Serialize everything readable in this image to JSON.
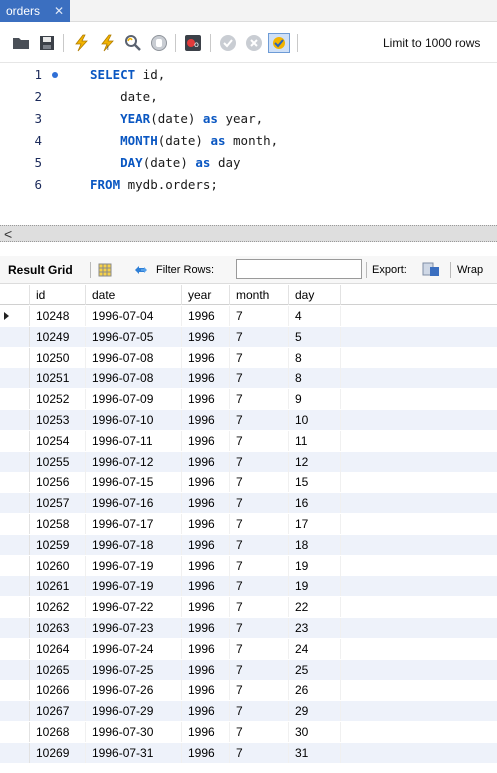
{
  "tab": {
    "label": "orders",
    "close_glyph": "✕"
  },
  "toolbar": {
    "icons": [
      "open-folder-icon",
      "save-icon",
      "execute-icon",
      "execute-current-icon",
      "explain-icon",
      "stop-icon",
      "toggle-error-icon",
      "commit-icon",
      "rollback-icon",
      "autocommit-icon"
    ],
    "limit_label": "Limit to 1000 rows"
  },
  "editor": {
    "lines": [
      {
        "num": "1",
        "parts": [
          [
            "kw",
            "SELECT"
          ],
          [
            "plain",
            " id,"
          ]
        ]
      },
      {
        "num": "2",
        "parts": [
          [
            "plain",
            "    date,"
          ]
        ]
      },
      {
        "num": "3",
        "parts": [
          [
            "plain",
            "    "
          ],
          [
            "fn",
            "YEAR"
          ],
          [
            "plain",
            "(date) "
          ],
          [
            "kw",
            "as"
          ],
          [
            "plain",
            " year,"
          ]
        ]
      },
      {
        "num": "4",
        "parts": [
          [
            "plain",
            "    "
          ],
          [
            "fn",
            "MONTH"
          ],
          [
            "plain",
            "(date) "
          ],
          [
            "kw",
            "as"
          ],
          [
            "plain",
            " month,"
          ]
        ]
      },
      {
        "num": "5",
        "parts": [
          [
            "plain",
            "    "
          ],
          [
            "fn",
            "DAY"
          ],
          [
            "plain",
            "(date) "
          ],
          [
            "kw",
            "as"
          ],
          [
            "plain",
            " day"
          ]
        ]
      },
      {
        "num": "6",
        "parts": [
          [
            "kw",
            "FROM"
          ],
          [
            "plain",
            " mydb.orders;"
          ]
        ]
      }
    ]
  },
  "scroll": {
    "left_arrow": "<"
  },
  "result_toolbar": {
    "result_grid_label": "Result Grid",
    "filter_label": "Filter Rows:",
    "filter_value": "",
    "export_label": "Export:",
    "wrap_label": "Wrap"
  },
  "grid": {
    "columns": [
      "id",
      "date",
      "year",
      "month",
      "day"
    ],
    "rows": [
      [
        "10248",
        "1996-07-04",
        "1996",
        "7",
        "4"
      ],
      [
        "10249",
        "1996-07-05",
        "1996",
        "7",
        "5"
      ],
      [
        "10250",
        "1996-07-08",
        "1996",
        "7",
        "8"
      ],
      [
        "10251",
        "1996-07-08",
        "1996",
        "7",
        "8"
      ],
      [
        "10252",
        "1996-07-09",
        "1996",
        "7",
        "9"
      ],
      [
        "10253",
        "1996-07-10",
        "1996",
        "7",
        "10"
      ],
      [
        "10254",
        "1996-07-11",
        "1996",
        "7",
        "11"
      ],
      [
        "10255",
        "1996-07-12",
        "1996",
        "7",
        "12"
      ],
      [
        "10256",
        "1996-07-15",
        "1996",
        "7",
        "15"
      ],
      [
        "10257",
        "1996-07-16",
        "1996",
        "7",
        "16"
      ],
      [
        "10258",
        "1996-07-17",
        "1996",
        "7",
        "17"
      ],
      [
        "10259",
        "1996-07-18",
        "1996",
        "7",
        "18"
      ],
      [
        "10260",
        "1996-07-19",
        "1996",
        "7",
        "19"
      ],
      [
        "10261",
        "1996-07-19",
        "1996",
        "7",
        "19"
      ],
      [
        "10262",
        "1996-07-22",
        "1996",
        "7",
        "22"
      ],
      [
        "10263",
        "1996-07-23",
        "1996",
        "7",
        "23"
      ],
      [
        "10264",
        "1996-07-24",
        "1996",
        "7",
        "24"
      ],
      [
        "10265",
        "1996-07-25",
        "1996",
        "7",
        "25"
      ],
      [
        "10266",
        "1996-07-26",
        "1996",
        "7",
        "26"
      ],
      [
        "10267",
        "1996-07-29",
        "1996",
        "7",
        "29"
      ],
      [
        "10268",
        "1996-07-30",
        "1996",
        "7",
        "30"
      ],
      [
        "10269",
        "1996-07-31",
        "1996",
        "7",
        "31"
      ]
    ]
  }
}
